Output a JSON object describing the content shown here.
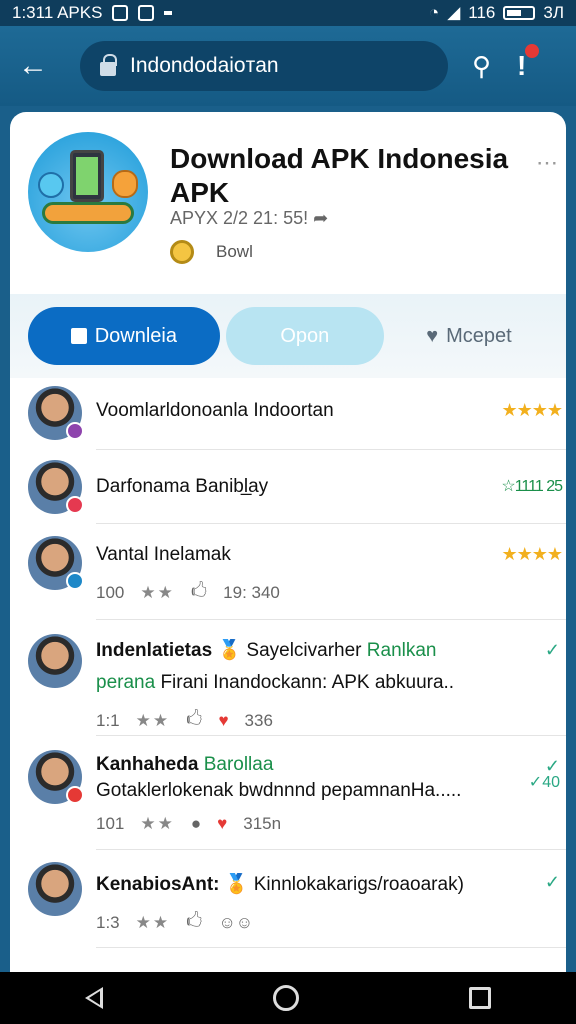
{
  "status_bar": {
    "time": "1:311 APKS",
    "right_text": "116",
    "battery_text": "3Л"
  },
  "address_bar": {
    "url": "Indondodaioтan"
  },
  "app": {
    "title": "Download APK Indonesia APK",
    "meta": "APYX 2/2 21: 55! ➦",
    "developer": "Bowl",
    "icon": "app-robot-phone-icon"
  },
  "actions": {
    "download_label": "Downleia",
    "open_label": "Opon",
    "save_label": "Mcepet"
  },
  "reviews": [
    {
      "name": "Voomlarldonoanla Indoortan",
      "stars": "★★★★",
      "badge_color": "#8e44ad"
    },
    {
      "name": "Darfonama Banibl̲ay",
      "score": "☆1111 25",
      "badge_color": "#e53950"
    },
    {
      "name": "Vantal Inelamak",
      "stars": "★★★★",
      "badge_color": "#1e88c8",
      "count": "100",
      "likes": "19: 340"
    },
    {
      "name": "Indenlatietas",
      "name_after": "Sayelcivarher",
      "name_green": "Ranlkan",
      "body_green": "perana",
      "body": "Firani Inandockann: APK abkuura..",
      "count": "1:1",
      "likes": "336"
    },
    {
      "name": "Kanhaheda",
      "name_green": "Barollaa",
      "body": "Gotaklerlokenak bwdnnnd pepamnanHa.....",
      "count": "101",
      "likes": "315n",
      "extra": "✓40",
      "badge_color": "#e53935"
    },
    {
      "name": "KenabiosAnt:",
      "name_after": "Kinnlokakarigs/roaoarak)",
      "count": "1:3"
    }
  ],
  "colors": {
    "primary": "#0b6cc4",
    "appbar": "#1a6a96",
    "star": "#f2b01e",
    "green": "#1a8f4a"
  }
}
